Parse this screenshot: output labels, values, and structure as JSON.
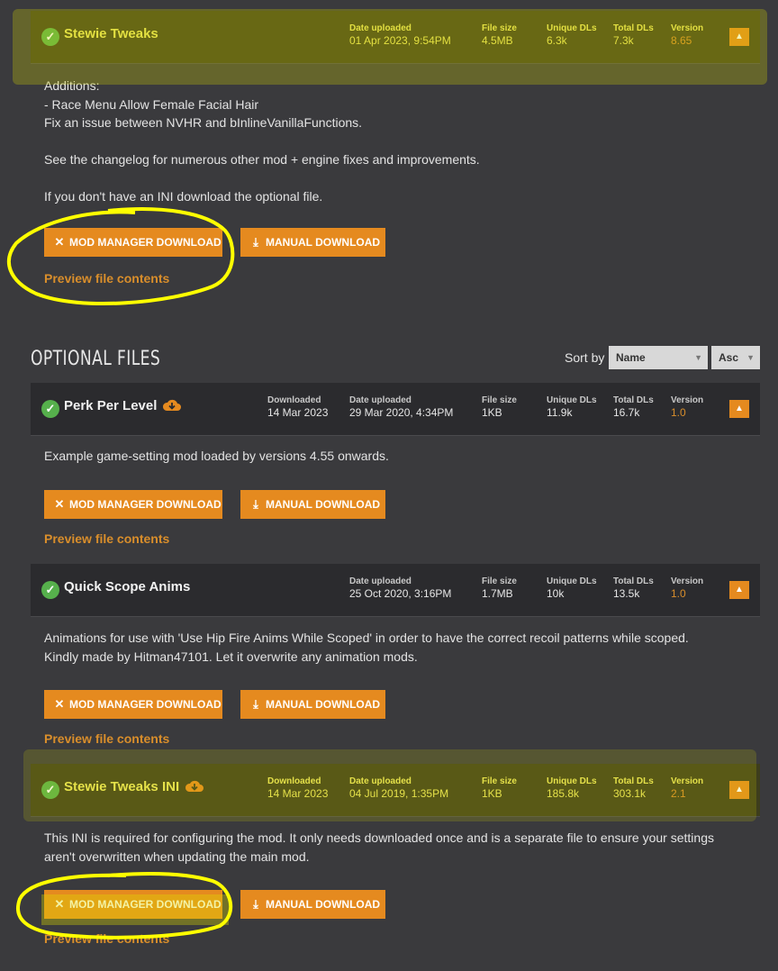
{
  "main_file": {
    "name": "Stewie Tweaks",
    "date_uploaded_label": "Date uploaded",
    "date_uploaded": "01 Apr 2023, 9:54PM",
    "file_size_label": "File size",
    "file_size": "4.5MB",
    "unique_dls_label": "Unique DLs",
    "unique_dls": "6.3k",
    "total_dls_label": "Total DLs",
    "total_dls": "7.3k",
    "version_label": "Version",
    "version": "8.65",
    "description": "Additions:\n- Race Menu Allow Female Facial Hair\nFix an issue between NVHR and bInlineVanillaFunctions.\n\nSee the changelog for numerous other mod + engine fixes and improvements.\n\nIf you don't have an INI download the optional file.",
    "mod_manager_label": "MOD MANAGER DOWNLOAD",
    "manual_label": "MANUAL DOWNLOAD",
    "preview_label": "Preview file contents"
  },
  "optional_section": {
    "title": "OPTIONAL FILES",
    "sort_by_label": "Sort by",
    "sort_field": "Name",
    "sort_order": "Asc"
  },
  "optional_files": [
    {
      "name": "Perk Per Level",
      "downloaded_label": "Downloaded",
      "downloaded": "14 Mar 2023",
      "date_uploaded_label": "Date uploaded",
      "date_uploaded": "29 Mar 2020, 4:34PM",
      "file_size_label": "File size",
      "file_size": "1KB",
      "unique_dls_label": "Unique DLs",
      "unique_dls": "11.9k",
      "total_dls_label": "Total DLs",
      "total_dls": "16.7k",
      "version_label": "Version",
      "version": "1.0",
      "description": "Example game-setting mod loaded by versions 4.55 onwards.",
      "mod_manager_label": "MOD MANAGER DOWNLOAD",
      "manual_label": "MANUAL DOWNLOAD",
      "preview_label": "Preview file contents"
    },
    {
      "name": "Quick Scope Anims",
      "date_uploaded_label": "Date uploaded",
      "date_uploaded": "25 Oct 2020, 3:16PM",
      "file_size_label": "File size",
      "file_size": "1.7MB",
      "unique_dls_label": "Unique DLs",
      "unique_dls": "10k",
      "total_dls_label": "Total DLs",
      "total_dls": "13.5k",
      "version_label": "Version",
      "version": "1.0",
      "description": "Animations for use with 'Use Hip Fire Anims While Scoped' in order to have the correct recoil patterns while scoped.\nKindly made by Hitman47101. Let it overwrite any animation mods.",
      "mod_manager_label": "MOD MANAGER DOWNLOAD",
      "manual_label": "MANUAL DOWNLOAD",
      "preview_label": "Preview file contents"
    },
    {
      "name": "Stewie Tweaks INI",
      "downloaded_label": "Downloaded",
      "downloaded": "14 Mar 2023",
      "date_uploaded_label": "Date uploaded",
      "date_uploaded": "04 Jul 2019, 1:35PM",
      "file_size_label": "File size",
      "file_size": "1KB",
      "unique_dls_label": "Unique DLs",
      "unique_dls": "185.8k",
      "total_dls_label": "Total DLs",
      "total_dls": "303.1k",
      "version_label": "Version",
      "version": "2.1",
      "description": "This INI is required for configuring the mod. It only needs downloaded once and is a separate file to ensure your settings\naren't overwritten when updating the main mod.",
      "mod_manager_label": "MOD MANAGER DOWNLOAD",
      "manual_label": "MANUAL DOWNLOAD",
      "preview_label": "Preview file contents"
    }
  ],
  "colors": {
    "accent": "#e58a1f",
    "check_green": "#56b04c",
    "highlighter": "#e8e800"
  }
}
